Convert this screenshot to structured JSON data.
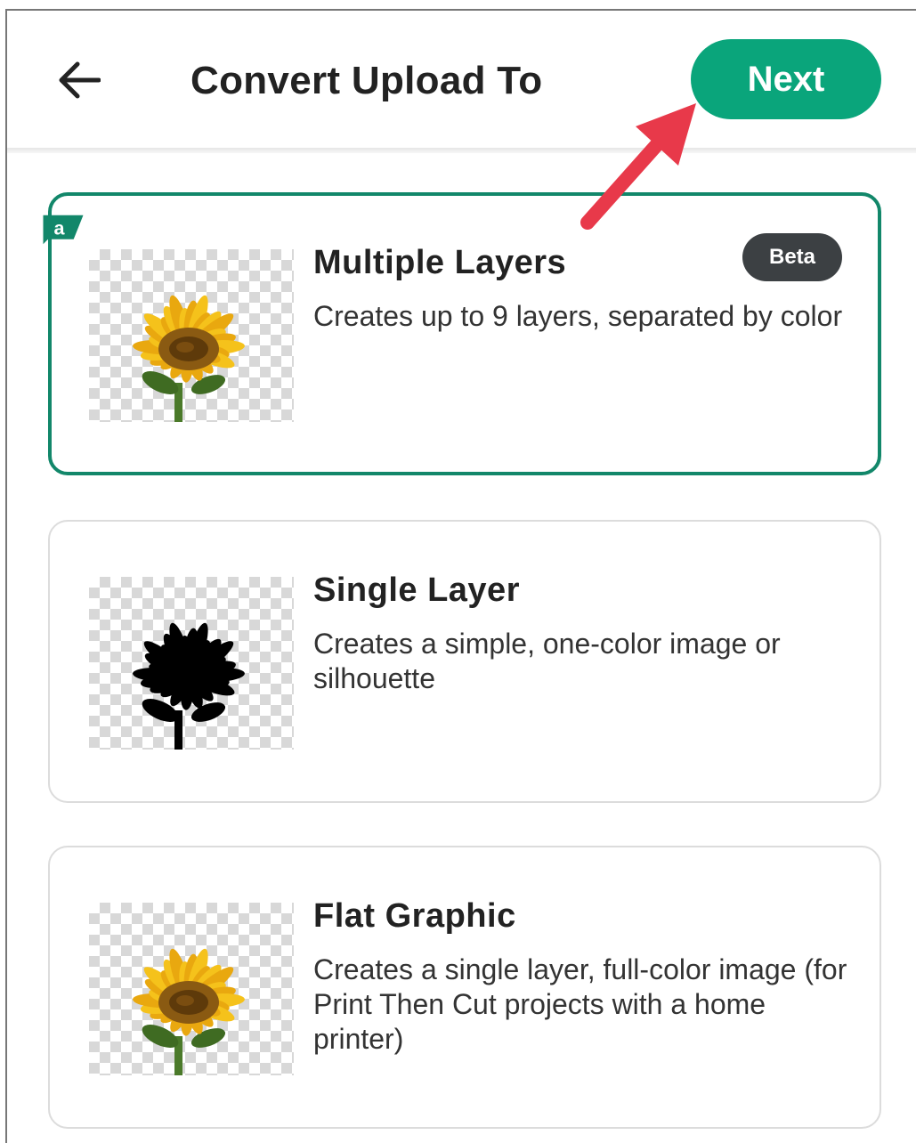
{
  "header": {
    "title": "Convert Upload To",
    "back_icon": "arrow-left-icon",
    "next_label": "Next"
  },
  "options": [
    {
      "title": "Multiple Layers",
      "description": "Creates up to 9 layers, separated by color",
      "badge": "Beta",
      "corner_badge_letter": "a",
      "selected": true,
      "thumbnail": "sunflower-color-image"
    },
    {
      "title": "Single Layer",
      "description": "Creates a simple, one-color image or silhouette",
      "selected": false,
      "thumbnail": "sunflower-silhouette-image"
    },
    {
      "title": "Flat Graphic",
      "description": "Creates a single layer, full-color image (for Print Then Cut projects with a home printer)",
      "selected": false,
      "thumbnail": "sunflower-color-image"
    }
  ],
  "colors": {
    "accent": "#0aa57b",
    "selected_border": "#12876a",
    "badge_bg": "#3c4043",
    "annotation_arrow": "#e8394a"
  }
}
